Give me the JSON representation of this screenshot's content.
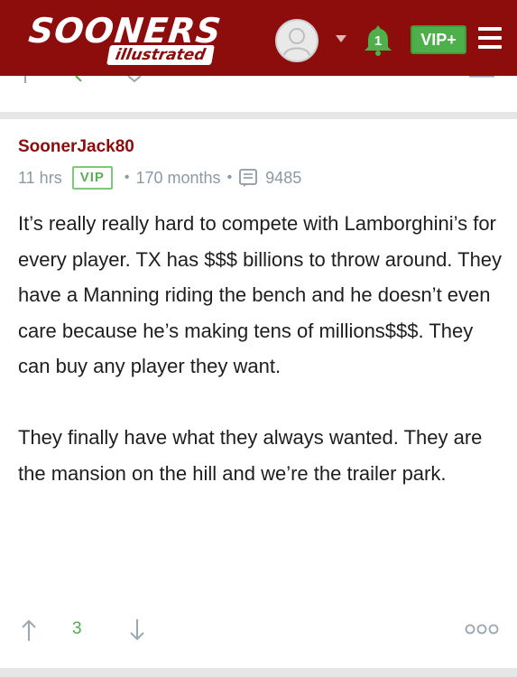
{
  "header": {
    "logo_main": "SOONERS",
    "logo_sub": "illustrated",
    "notification_count": "1",
    "vip_label": "VIP+",
    "brand_color": "#8d0c0c",
    "vip_color": "#4db04a",
    "icons": [
      "avatar-icon",
      "caret-down-icon",
      "bell-icon",
      "hamburger-menu-icon"
    ]
  },
  "post": {
    "username": "SoonerJack80",
    "time": "11 hrs",
    "badge": "VIP",
    "membership": "170 months",
    "post_count": "9485",
    "paragraphs": [
      "It’s really really hard to compete with Lamborghini’s for every player. TX has $$$ billions to throw around. They have a Manning riding the bench and he doesn’t even care because he’s making tens of millions$$$. They can buy any player they want.",
      "They finally have what they always wanted. They are the mansion on the hill and we’re the trailer park."
    ],
    "votes": "3",
    "icons": [
      "posts-icon",
      "upvote-icon",
      "downvote-icon",
      "more-options-icon"
    ]
  }
}
